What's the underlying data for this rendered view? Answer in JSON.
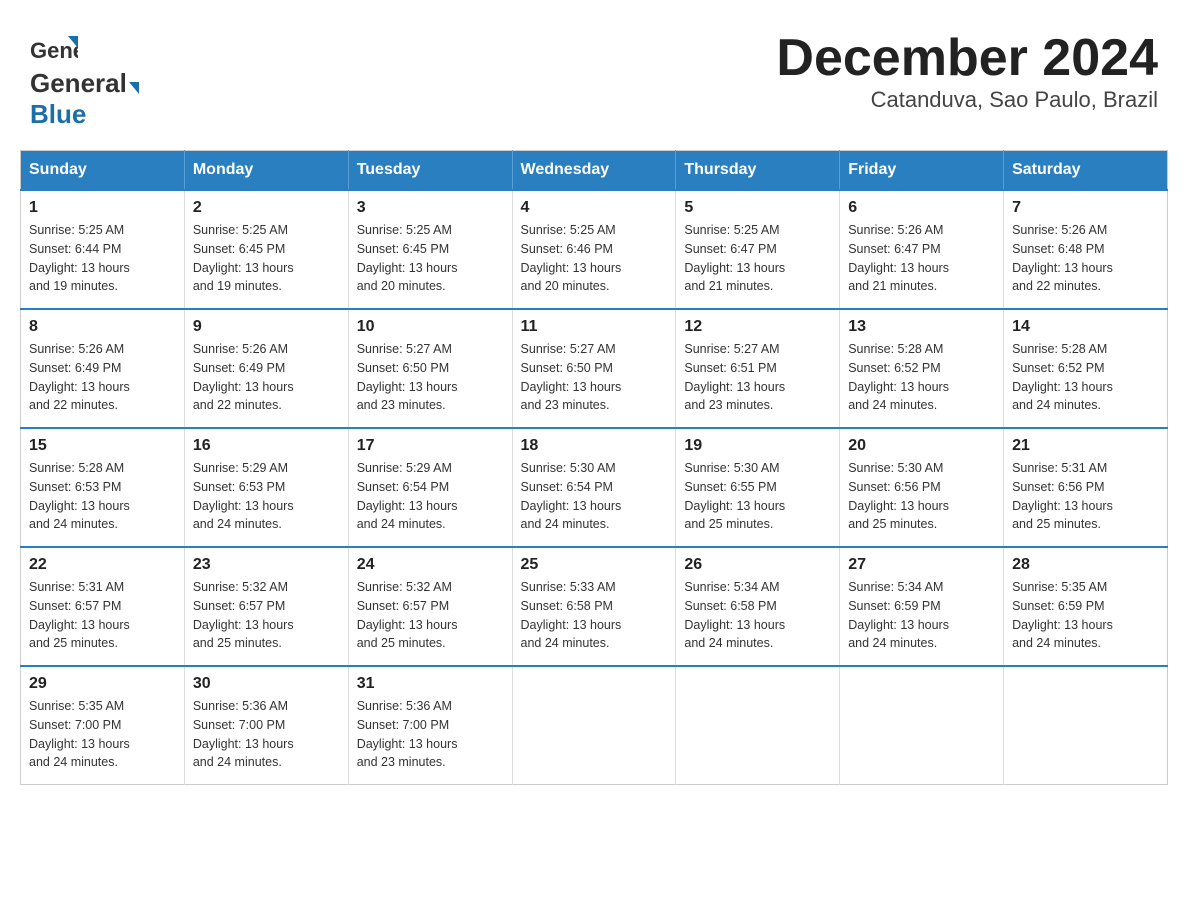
{
  "header": {
    "logo_general": "General",
    "logo_blue": "Blue",
    "title": "December 2024",
    "subtitle": "Catanduva, Sao Paulo, Brazil"
  },
  "days_of_week": [
    "Sunday",
    "Monday",
    "Tuesday",
    "Wednesday",
    "Thursday",
    "Friday",
    "Saturday"
  ],
  "weeks": [
    [
      {
        "day": "1",
        "sunrise": "5:25 AM",
        "sunset": "6:44 PM",
        "daylight_hours": "13",
        "daylight_minutes": "19"
      },
      {
        "day": "2",
        "sunrise": "5:25 AM",
        "sunset": "6:45 PM",
        "daylight_hours": "13",
        "daylight_minutes": "19"
      },
      {
        "day": "3",
        "sunrise": "5:25 AM",
        "sunset": "6:45 PM",
        "daylight_hours": "13",
        "daylight_minutes": "20"
      },
      {
        "day": "4",
        "sunrise": "5:25 AM",
        "sunset": "6:46 PM",
        "daylight_hours": "13",
        "daylight_minutes": "20"
      },
      {
        "day": "5",
        "sunrise": "5:25 AM",
        "sunset": "6:47 PM",
        "daylight_hours": "13",
        "daylight_minutes": "21"
      },
      {
        "day": "6",
        "sunrise": "5:26 AM",
        "sunset": "6:47 PM",
        "daylight_hours": "13",
        "daylight_minutes": "21"
      },
      {
        "day": "7",
        "sunrise": "5:26 AM",
        "sunset": "6:48 PM",
        "daylight_hours": "13",
        "daylight_minutes": "22"
      }
    ],
    [
      {
        "day": "8",
        "sunrise": "5:26 AM",
        "sunset": "6:49 PM",
        "daylight_hours": "13",
        "daylight_minutes": "22"
      },
      {
        "day": "9",
        "sunrise": "5:26 AM",
        "sunset": "6:49 PM",
        "daylight_hours": "13",
        "daylight_minutes": "22"
      },
      {
        "day": "10",
        "sunrise": "5:27 AM",
        "sunset": "6:50 PM",
        "daylight_hours": "13",
        "daylight_minutes": "23"
      },
      {
        "day": "11",
        "sunrise": "5:27 AM",
        "sunset": "6:50 PM",
        "daylight_hours": "13",
        "daylight_minutes": "23"
      },
      {
        "day": "12",
        "sunrise": "5:27 AM",
        "sunset": "6:51 PM",
        "daylight_hours": "13",
        "daylight_minutes": "23"
      },
      {
        "day": "13",
        "sunrise": "5:28 AM",
        "sunset": "6:52 PM",
        "daylight_hours": "13",
        "daylight_minutes": "24"
      },
      {
        "day": "14",
        "sunrise": "5:28 AM",
        "sunset": "6:52 PM",
        "daylight_hours": "13",
        "daylight_minutes": "24"
      }
    ],
    [
      {
        "day": "15",
        "sunrise": "5:28 AM",
        "sunset": "6:53 PM",
        "daylight_hours": "13",
        "daylight_minutes": "24"
      },
      {
        "day": "16",
        "sunrise": "5:29 AM",
        "sunset": "6:53 PM",
        "daylight_hours": "13",
        "daylight_minutes": "24"
      },
      {
        "day": "17",
        "sunrise": "5:29 AM",
        "sunset": "6:54 PM",
        "daylight_hours": "13",
        "daylight_minutes": "24"
      },
      {
        "day": "18",
        "sunrise": "5:30 AM",
        "sunset": "6:54 PM",
        "daylight_hours": "13",
        "daylight_minutes": "24"
      },
      {
        "day": "19",
        "sunrise": "5:30 AM",
        "sunset": "6:55 PM",
        "daylight_hours": "13",
        "daylight_minutes": "25"
      },
      {
        "day": "20",
        "sunrise": "5:30 AM",
        "sunset": "6:56 PM",
        "daylight_hours": "13",
        "daylight_minutes": "25"
      },
      {
        "day": "21",
        "sunrise": "5:31 AM",
        "sunset": "6:56 PM",
        "daylight_hours": "13",
        "daylight_minutes": "25"
      }
    ],
    [
      {
        "day": "22",
        "sunrise": "5:31 AM",
        "sunset": "6:57 PM",
        "daylight_hours": "13",
        "daylight_minutes": "25"
      },
      {
        "day": "23",
        "sunrise": "5:32 AM",
        "sunset": "6:57 PM",
        "daylight_hours": "13",
        "daylight_minutes": "25"
      },
      {
        "day": "24",
        "sunrise": "5:32 AM",
        "sunset": "6:57 PM",
        "daylight_hours": "13",
        "daylight_minutes": "25"
      },
      {
        "day": "25",
        "sunrise": "5:33 AM",
        "sunset": "6:58 PM",
        "daylight_hours": "13",
        "daylight_minutes": "24"
      },
      {
        "day": "26",
        "sunrise": "5:34 AM",
        "sunset": "6:58 PM",
        "daylight_hours": "13",
        "daylight_minutes": "24"
      },
      {
        "day": "27",
        "sunrise": "5:34 AM",
        "sunset": "6:59 PM",
        "daylight_hours": "13",
        "daylight_minutes": "24"
      },
      {
        "day": "28",
        "sunrise": "5:35 AM",
        "sunset": "6:59 PM",
        "daylight_hours": "13",
        "daylight_minutes": "24"
      }
    ],
    [
      {
        "day": "29",
        "sunrise": "5:35 AM",
        "sunset": "7:00 PM",
        "daylight_hours": "13",
        "daylight_minutes": "24"
      },
      {
        "day": "30",
        "sunrise": "5:36 AM",
        "sunset": "7:00 PM",
        "daylight_hours": "13",
        "daylight_minutes": "24"
      },
      {
        "day": "31",
        "sunrise": "5:36 AM",
        "sunset": "7:00 PM",
        "daylight_hours": "13",
        "daylight_minutes": "23"
      },
      {
        "day": "",
        "sunrise": "",
        "sunset": "",
        "daylight_hours": "",
        "daylight_minutes": ""
      },
      {
        "day": "",
        "sunrise": "",
        "sunset": "",
        "daylight_hours": "",
        "daylight_minutes": ""
      },
      {
        "day": "",
        "sunrise": "",
        "sunset": "",
        "daylight_hours": "",
        "daylight_minutes": ""
      },
      {
        "day": "",
        "sunrise": "",
        "sunset": "",
        "daylight_hours": "",
        "daylight_minutes": ""
      }
    ]
  ],
  "labels": {
    "sunrise": "Sunrise: ",
    "sunset": "Sunset: ",
    "daylight": "Daylight: ",
    "hours": " hours",
    "and": "and ",
    "minutes": " minutes."
  }
}
